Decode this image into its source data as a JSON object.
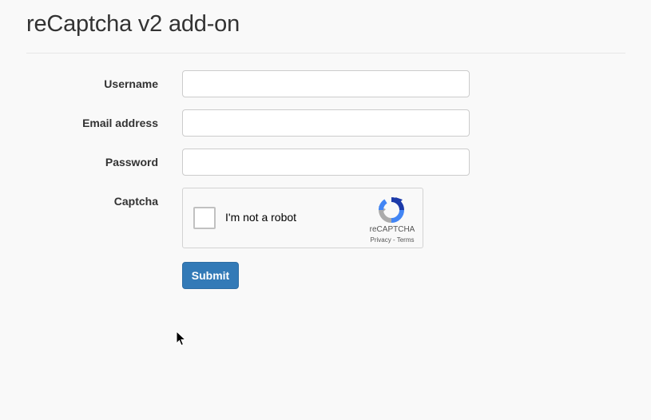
{
  "page": {
    "title": "reCaptcha v2 add-on"
  },
  "form": {
    "username": {
      "label": "Username",
      "value": "",
      "placeholder": ""
    },
    "email": {
      "label": "Email address",
      "value": "",
      "placeholder": ""
    },
    "password": {
      "label": "Password",
      "value": "",
      "placeholder": ""
    },
    "captcha": {
      "label": "Captcha",
      "checkbox_text": "I'm not a robot",
      "brand": "reCAPTCHA",
      "privacy_link": "Privacy",
      "separator": " - ",
      "terms_link": "Terms",
      "checked": false
    },
    "submit_label": "Submit"
  },
  "colors": {
    "background": "#f9f9f9",
    "primary_button": "#337ab7",
    "text": "#333333",
    "input_border": "#cccccc"
  },
  "icons": {
    "captcha_logo": "recaptcha-logo-icon",
    "cursor": "mouse-pointer-icon"
  }
}
